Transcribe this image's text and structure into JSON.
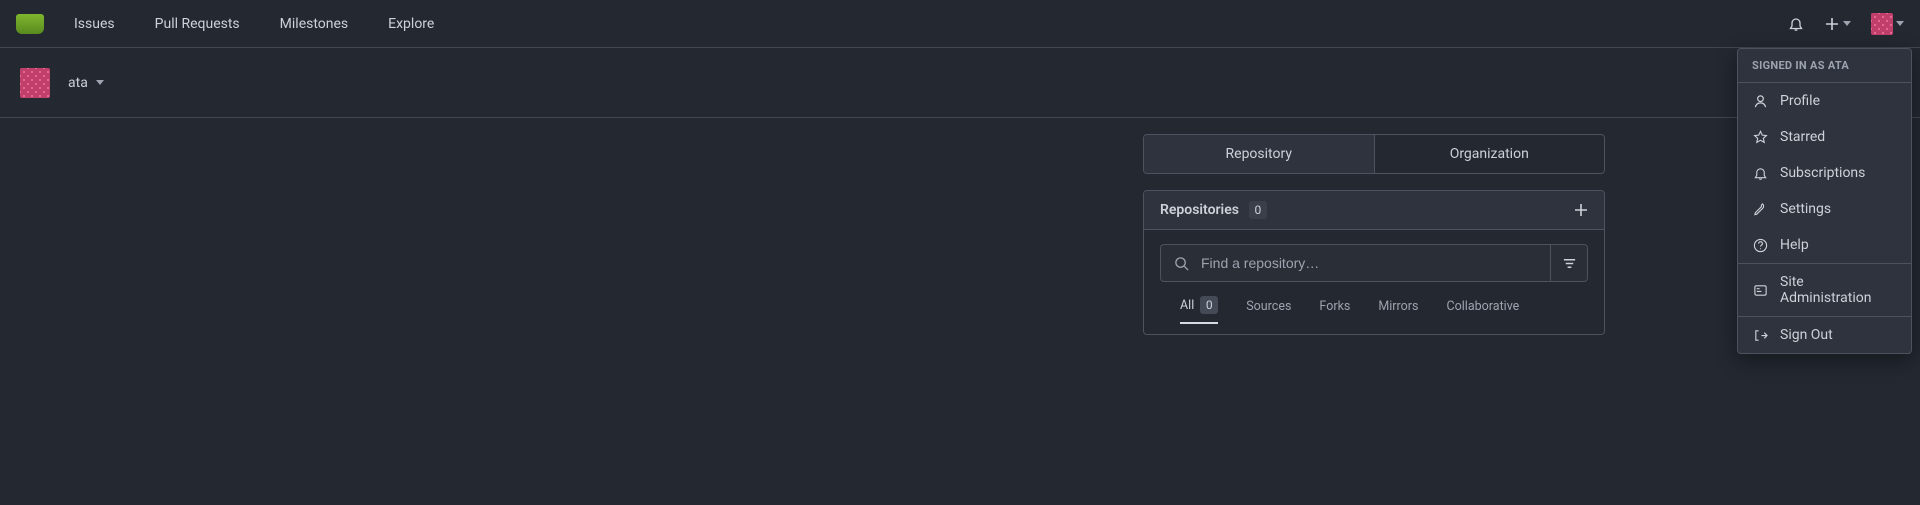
{
  "nav": {
    "issues": "Issues",
    "pulls": "Pull Requests",
    "milestones": "Milestones",
    "explore": "Explore"
  },
  "context": {
    "username": "ata"
  },
  "panel": {
    "switch": {
      "repo": "Repository",
      "org": "Organization"
    },
    "repos_title": "Repositories",
    "repos_count": "0",
    "search_placeholder": "Find a repository…",
    "tabs": {
      "all": "All",
      "all_count": "0",
      "sources": "Sources",
      "forks": "Forks",
      "mirrors": "Mirrors",
      "collab": "Collaborative"
    }
  },
  "menu": {
    "header_prefix": "SIGNED IN AS ",
    "header_user": "ATA",
    "profile": "Profile",
    "starred": "Starred",
    "subs": "Subscriptions",
    "settings": "Settings",
    "help": "Help",
    "admin": "Site Administration",
    "signout": "Sign Out"
  }
}
